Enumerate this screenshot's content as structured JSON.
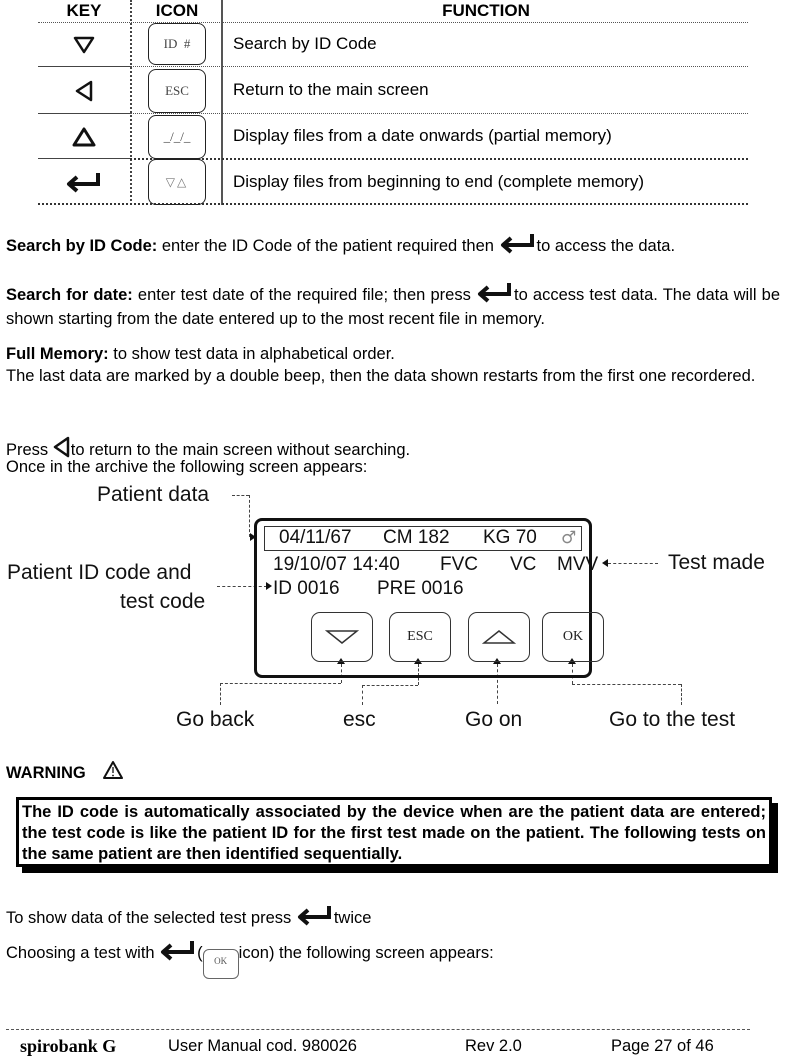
{
  "table": {
    "headers": {
      "key": "KEY",
      "icon": "ICON",
      "function": "FUNCTION"
    },
    "rows": [
      {
        "key_icon": "down-triangle-icon",
        "icon_label": "ID  #",
        "function": "Search by ID Code"
      },
      {
        "key_icon": "left-triangle-icon",
        "icon_label": "ESC",
        "function": "Return to the main screen"
      },
      {
        "key_icon": "up-triangle-icon",
        "icon_label": "_/_/_",
        "function": "Display files from a date onwards (partial memory)"
      },
      {
        "key_icon": "enter-arrow-icon",
        "icon_label": "▽△",
        "function": "Display files from beginning to end (complete memory)"
      }
    ]
  },
  "paragraphs": {
    "search_id": {
      "label": "Search by ID Code:",
      "before": " enter the ID Code of the patient required then ",
      "after": "to access the data."
    },
    "search_date": {
      "label": "Search for date:",
      "before": " enter test date of the required file; then press ",
      "after": "to access test data. The data will be shown starting from the date entered up to the most recent file in memory."
    },
    "full_memory": {
      "label": "Full Memory:",
      "text": " to show test data in alphabetical order.",
      "text2": "The last data are marked by a double beep, then the data shown restarts from the first one recordered."
    },
    "press": {
      "before": "Press ",
      "after": "to return to the main screen without searching.",
      "line2": "Once in the archive the following screen appears:"
    }
  },
  "diagram": {
    "lcd": {
      "dob": "04/11/67",
      "height": "CM 182",
      "weight": "KG 70",
      "sex_symbol": "♂",
      "datetime": "19/10/07 14:40",
      "test1": "FVC",
      "test2": "VC",
      "test3": "MVV",
      "patient_id": "ID 0016",
      "test_code": "PRE 0016"
    },
    "buttons": {
      "down": "▽",
      "esc": "ESC",
      "up": "△",
      "ok": "OK"
    },
    "callouts": {
      "patient_data": "Patient data",
      "patient_id_line1": "Patient ID code and",
      "patient_id_line2": "test code",
      "test_made": "Test made",
      "go_back": "Go back",
      "esc": "esc",
      "go_on": "Go on",
      "go_to_test": "Go to the test"
    }
  },
  "warning": {
    "title": "WARNING",
    "text": "The ID code is automatically associated by the device when are the patient data are entered; the test code is like the patient ID for the first test made on the patient. The following tests on the same patient are then identified sequentially."
  },
  "instructions": {
    "line1_before": "To show data of the selected test press ",
    "line1_after": "twice",
    "line2_before": "Choosing a test with ",
    "line2_paren_open": "(",
    "ok_label": "OK",
    "line2_after": "icon) the following screen appears:"
  },
  "footer": {
    "brand": "spirobank G",
    "manual": "User Manual cod. 980026",
    "rev": "Rev 2.0",
    "page": "Page 27 of 46"
  }
}
